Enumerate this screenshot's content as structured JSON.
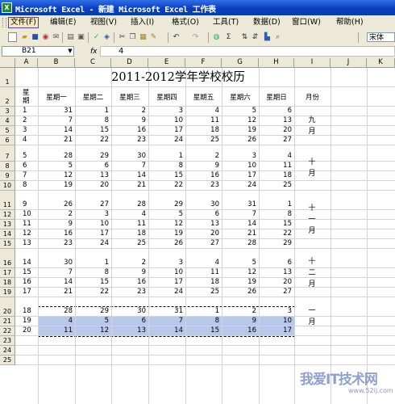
{
  "window": {
    "title": "Microsoft Excel - 新建 Microsoft Excel 工作表",
    "icon": "excel-app-icon"
  },
  "menu": [
    "文件(F)",
    "编辑(E)",
    "视图(V)",
    "插入(I)",
    "格式(O)",
    "工具(T)",
    "数据(D)",
    "窗口(W)",
    "帮助(H)"
  ],
  "toolbar": {
    "font_name": "宋体",
    "icons": [
      "new-icon",
      "open-icon",
      "save-icon",
      "permission-icon",
      "mail-icon",
      "print-icon",
      "print-preview-icon",
      "spelling-icon",
      "research-icon",
      "cut-icon",
      "copy-icon",
      "paste-icon",
      "format-painter-icon",
      "undo-icon",
      "redo-icon",
      "hyperlink-icon",
      "autosum-icon",
      "sort-ascending-icon",
      "sort-descending-icon",
      "chart-wizard-icon",
      "zoom-icon"
    ]
  },
  "formula_bar": {
    "name_box": "B21",
    "fx_label": "fx",
    "value": "4"
  },
  "columns": [
    "A",
    "B",
    "C",
    "D",
    "E",
    "F",
    "G",
    "H",
    "I",
    "J",
    "K"
  ],
  "rows": [
    "1",
    "2",
    "3",
    "4",
    "5",
    "6",
    "7",
    "8",
    "9",
    "10",
    "11",
    "12",
    "13",
    "14",
    "15",
    "16",
    "17",
    "18",
    "19",
    "20",
    "21",
    "22",
    "23",
    "24",
    "25"
  ],
  "sheet": {
    "title": "2011-2012学年学校校历",
    "headers": [
      "星期",
      "星期一",
      "星期二",
      "星期三",
      "星期四",
      "星期五",
      "星期六",
      "星期日",
      "月份"
    ],
    "weeks": [
      {
        "w": "1",
        "d": [
          "31",
          "1",
          "2",
          "3",
          "4",
          "5",
          "6"
        ]
      },
      {
        "w": "2",
        "d": [
          "7",
          "8",
          "9",
          "10",
          "11",
          "12",
          "13"
        ]
      },
      {
        "w": "3",
        "d": [
          "14",
          "15",
          "16",
          "17",
          "18",
          "19",
          "20"
        ]
      },
      {
        "w": "4",
        "d": [
          "21",
          "22",
          "23",
          "24",
          "25",
          "26",
          "27"
        ]
      },
      {
        "w": "5",
        "d": [
          "28",
          "29",
          "30",
          "1",
          "2",
          "3",
          "4"
        ]
      },
      {
        "w": "6",
        "d": [
          "5",
          "6",
          "7",
          "8",
          "9",
          "10",
          "11"
        ]
      },
      {
        "w": "7",
        "d": [
          "12",
          "13",
          "14",
          "15",
          "16",
          "17",
          "18"
        ]
      },
      {
        "w": "8",
        "d": [
          "19",
          "20",
          "21",
          "22",
          "23",
          "24",
          "25"
        ]
      },
      {
        "w": "9",
        "d": [
          "26",
          "27",
          "28",
          "29",
          "30",
          "31",
          "1"
        ]
      },
      {
        "w": "10",
        "d": [
          "2",
          "3",
          "4",
          "5",
          "6",
          "7",
          "8"
        ]
      },
      {
        "w": "11",
        "d": [
          "9",
          "10",
          "11",
          "12",
          "13",
          "14",
          "15"
        ]
      },
      {
        "w": "12",
        "d": [
          "16",
          "17",
          "18",
          "19",
          "20",
          "21",
          "22"
        ]
      },
      {
        "w": "13",
        "d": [
          "23",
          "24",
          "25",
          "26",
          "27",
          "28",
          "29"
        ]
      },
      {
        "w": "14",
        "d": [
          "30",
          "1",
          "2",
          "3",
          "4",
          "5",
          "6"
        ]
      },
      {
        "w": "15",
        "d": [
          "7",
          "8",
          "9",
          "10",
          "11",
          "12",
          "13"
        ]
      },
      {
        "w": "16",
        "d": [
          "14",
          "15",
          "16",
          "17",
          "18",
          "19",
          "20"
        ]
      },
      {
        "w": "17",
        "d": [
          "21",
          "22",
          "23",
          "24",
          "25",
          "26",
          "27"
        ]
      },
      {
        "w": "18",
        "d": [
          "28",
          "29",
          "30",
          "31",
          "1",
          "2",
          "3"
        ]
      },
      {
        "w": "19",
        "d": [
          "4",
          "5",
          "6",
          "7",
          "8",
          "9",
          "10"
        ]
      },
      {
        "w": "20",
        "d": [
          "11",
          "12",
          "13",
          "14",
          "15",
          "16",
          "17"
        ]
      }
    ],
    "months": [
      "九月",
      "十月",
      "十一月",
      "十二月",
      "一月"
    ]
  },
  "watermark": {
    "text": "我爱IT技术网",
    "url": "www.52ij.com"
  },
  "colors": {
    "title_bar": "#0a3fc1",
    "chrome": "#ece9d8",
    "selection": "#b8c8e8"
  }
}
